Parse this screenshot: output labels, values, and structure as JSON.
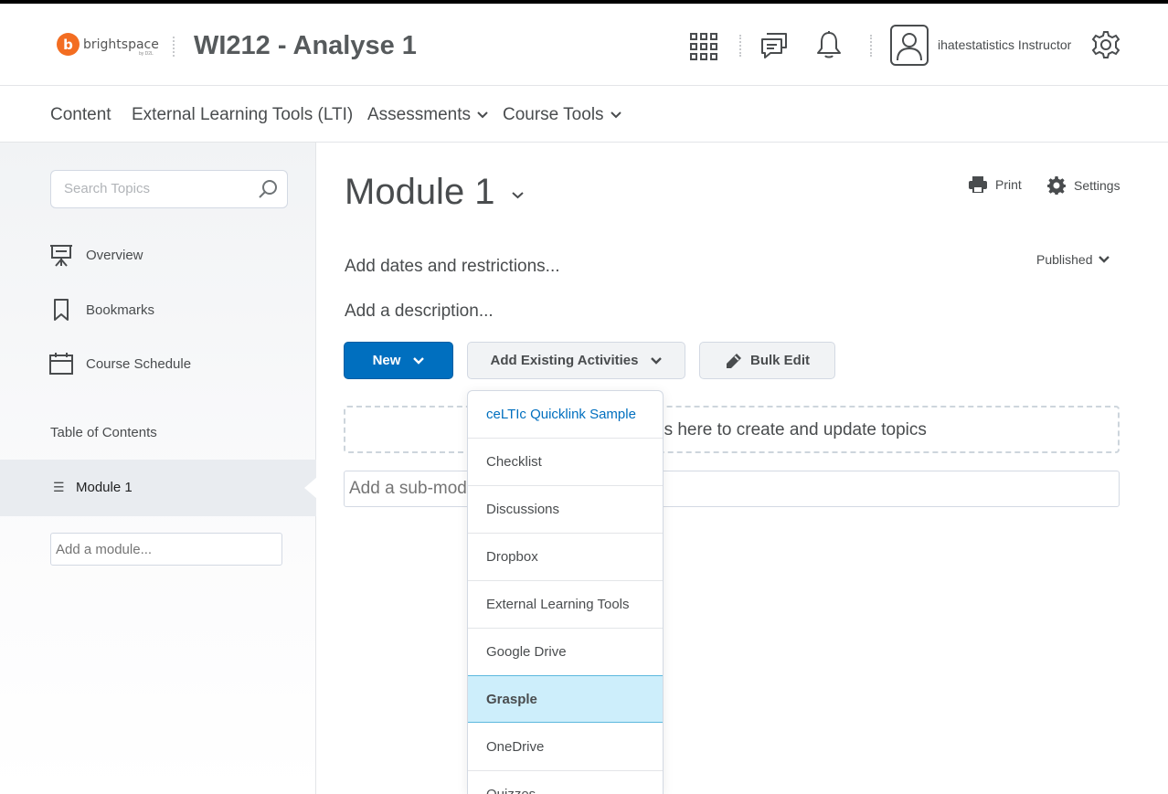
{
  "header": {
    "logo_letter": "b",
    "logo_text": "brightspace",
    "logo_sub": "by D2L",
    "course_title": "WI212 - Analyse 1",
    "user_name": "ihatestatistics Instructor",
    "icons": [
      "waffle-grid-icon",
      "chat-icon",
      "bell-icon",
      "user-avatar-icon",
      "gear-icon"
    ]
  },
  "nav": {
    "items": [
      {
        "label": "Content",
        "has_menu": false
      },
      {
        "label": "External Learning Tools (LTI)",
        "has_menu": false
      },
      {
        "label": "Assessments",
        "has_menu": true
      },
      {
        "label": "Course Tools",
        "has_menu": true
      }
    ]
  },
  "sidebar": {
    "search_placeholder": "Search Topics",
    "links": [
      {
        "label": "Overview",
        "icon": "presentation-icon"
      },
      {
        "label": "Bookmarks",
        "icon": "bookmark-icon"
      },
      {
        "label": "Course Schedule",
        "icon": "calendar-icon"
      }
    ],
    "toc_label": "Table of Contents",
    "modules": [
      {
        "label": "Module 1",
        "selected": true
      }
    ],
    "add_module_placeholder": "Add a module..."
  },
  "main": {
    "title": "Module 1",
    "print_label": "Print",
    "settings_label": "Settings",
    "dates_link": "Add dates and restrictions...",
    "description_link": "Add a description...",
    "status_label": "Published",
    "new_button": "New",
    "add_existing_button": "Add Existing Activities",
    "bulk_edit_button": "Bulk Edit",
    "dropzone_text": "es here to create and update topics",
    "submodule_placeholder": "Add a sub-module..."
  },
  "menu": {
    "items": [
      {
        "label": "ceLTIc Quicklink Sample",
        "link": true
      },
      {
        "label": "Checklist"
      },
      {
        "label": "Discussions"
      },
      {
        "label": "Dropbox"
      },
      {
        "label": "External Learning Tools"
      },
      {
        "label": "Google Drive"
      },
      {
        "label": "Grasple",
        "active": true
      },
      {
        "label": "OneDrive"
      },
      {
        "label": "Quizzes"
      }
    ]
  },
  "colors": {
    "primary": "#006fbf",
    "logo_orange": "#f36d21",
    "text": "#494c4e",
    "active_item_bg": "#cdeefb"
  }
}
